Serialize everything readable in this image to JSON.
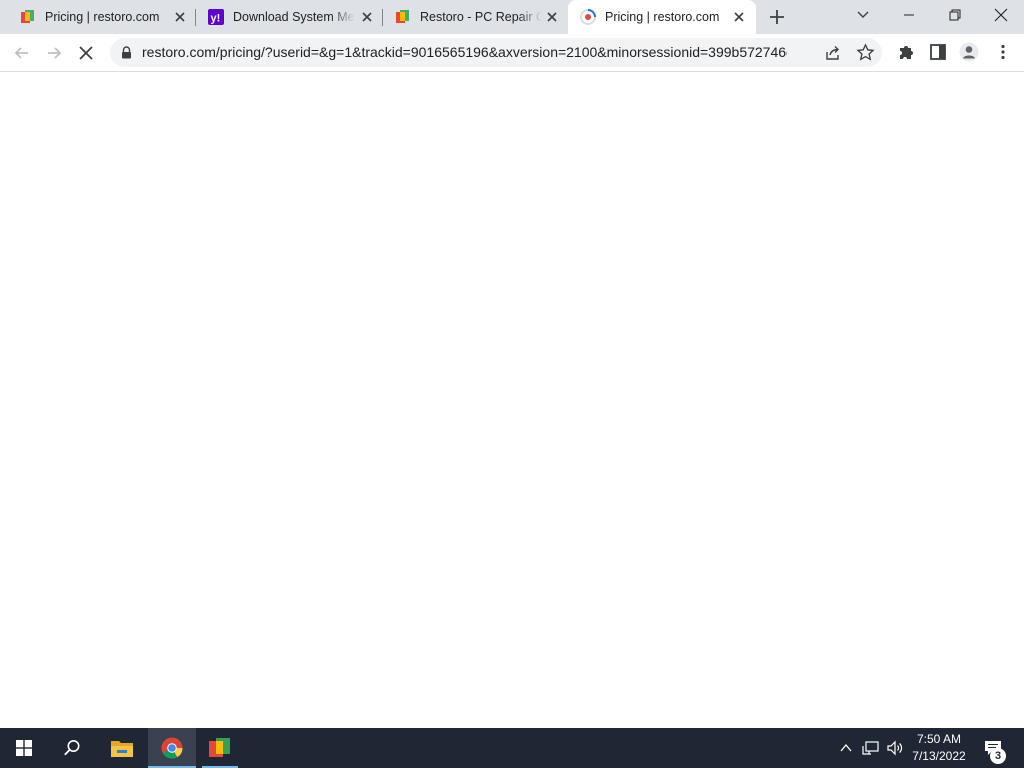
{
  "tabs": [
    {
      "title": "Pricing | restoro.com",
      "favicon": "restoro-icon"
    },
    {
      "title": "Download System Mec",
      "favicon": "yahoo-icon"
    },
    {
      "title": "Restoro - PC Repair Or",
      "favicon": "restoro-icon"
    },
    {
      "title": "Pricing | restoro.com",
      "favicon": "chrome-loading-icon",
      "active": true
    }
  ],
  "toolbar": {
    "url": "restoro.com/pricing/?userid=&g=1&trackid=9016565196&axversion=2100&minorsessionid=399b572746d..."
  },
  "taskbar": {
    "time": "7:50 AM",
    "date": "7/13/2022",
    "notification_count": "3"
  },
  "colors": {
    "tabstrip_bg": "#dee1e6",
    "taskbar_bg": "#1f2634",
    "yahoo_purple": "#6001d2",
    "chrome_active_indicator": "#76b9ed"
  }
}
